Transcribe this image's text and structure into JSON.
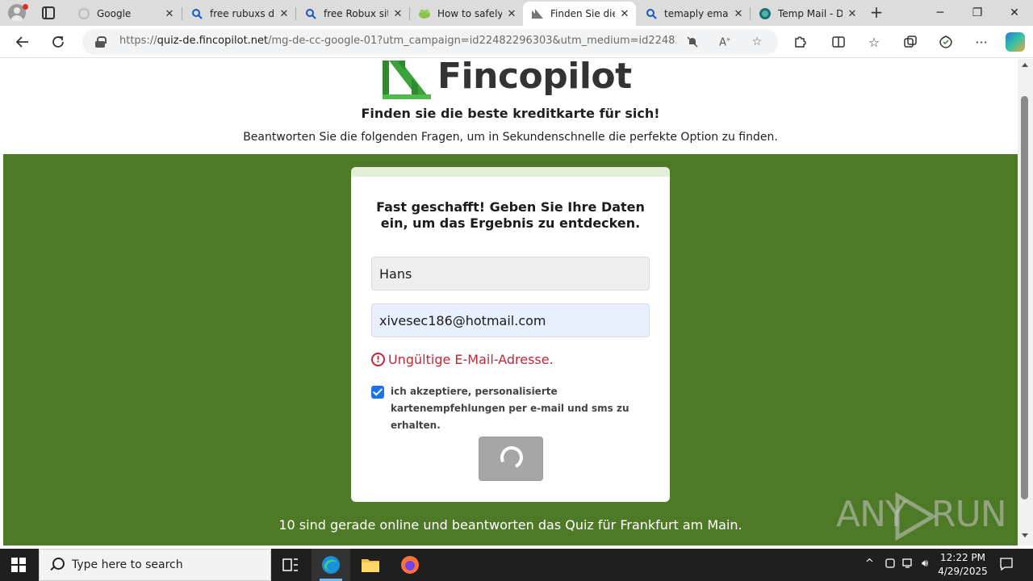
{
  "browser": {
    "tabs": [
      {
        "title": "Google",
        "favicon": "google-icon"
      },
      {
        "title": "free rubuxs do",
        "favicon": "search-icon"
      },
      {
        "title": "free Robux site",
        "favicon": "search-icon"
      },
      {
        "title": "How to safely",
        "favicon": "frog-icon"
      },
      {
        "title": "Finden Sie die",
        "favicon": "fincopilot-icon",
        "active": true
      },
      {
        "title": "temaply email",
        "favicon": "search-icon"
      },
      {
        "title": "Temp Mail - D",
        "favicon": "tempmail-icon"
      }
    ],
    "url": {
      "scheme": "https://",
      "host": "quiz-de.fincopilot.net",
      "path": "/mg-de-cc-google-01?utm_campaign=id22482296303&utm_medium=id224822..."
    }
  },
  "page": {
    "logo_text": "Fincopilot",
    "tagline": "Finden sie die beste kreditkarte für sich!",
    "subline": "Beantworten Sie die folgenden Fragen, um in Sekundenschnelle die perfekte Option zu finden.",
    "form": {
      "title": "Fast geschafft! Geben Sie Ihre Daten ein, um das Ergebnis zu entdecken.",
      "name_value": "Hans",
      "email_value": "xivesec186@hotmail.com",
      "error": "Ungültige E-Mail-Adresse.",
      "consent": "ich akzeptiere, personalisierte kartenempfehlungen per e-mail und sms zu erhalten.",
      "consent_checked": true
    },
    "online_text": "10 sind gerade online und beantworten das Quiz für Frankfurt am Main."
  },
  "watermark": {
    "left": "ANY",
    "right": "RUN"
  },
  "taskbar": {
    "search_placeholder": "Type here to search",
    "time": "12:22 PM",
    "date": "4/29/2025"
  },
  "colors": {
    "brand_green": "#4e7a27",
    "error_red": "#c0283a",
    "checkbox_blue": "#1a73e8"
  }
}
